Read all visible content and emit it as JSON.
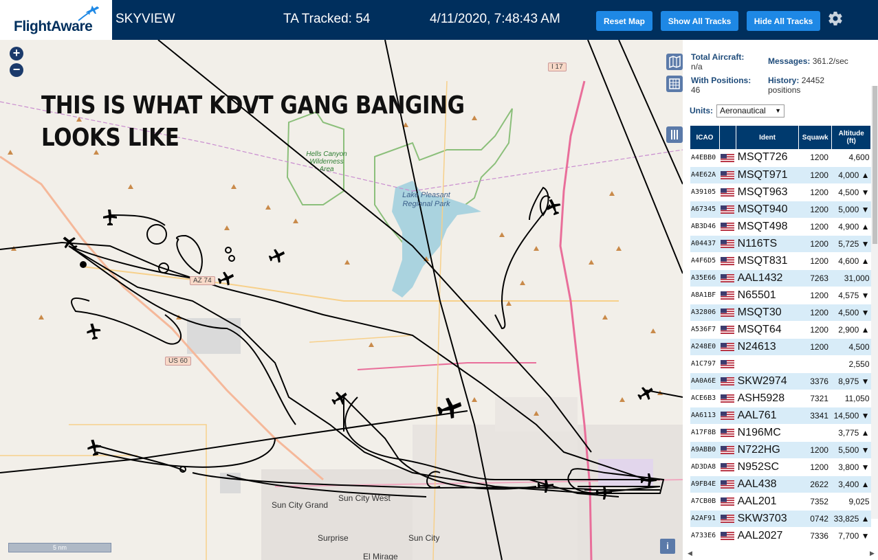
{
  "header": {
    "logo_text": "FlightAware",
    "app_title": "SKYVIEW",
    "ta_tracked": "TA Tracked: 54",
    "datetime": "4/11/2020, 7:48:43 AM",
    "reset_map": "Reset Map",
    "show_all_tracks": "Show All Tracks",
    "hide_all_tracks": "Hide All Tracks"
  },
  "map": {
    "overlay_line1": "THIS IS WHAT KDVT GANG BANGING",
    "overlay_line2": "LOOKS LIKE",
    "zoom_in": "+",
    "zoom_out": "−",
    "scale": "5 nm",
    "info": "i",
    "labels": {
      "park": "Hells Canyon Wilderness Area",
      "lake": "Lake Pleasant Regional Park",
      "sun_city_grand": "Sun City Grand",
      "sun_city_west": "Sun City West",
      "surprise": "Surprise",
      "sun_city": "Sun City",
      "el_mirage": "El Mirage",
      "az74": "AZ 74",
      "us60": "US 60",
      "i17": "I 17"
    }
  },
  "stats": {
    "total_aircraft_label": "Total Aircraft:",
    "total_aircraft_value": "n/a",
    "messages_label": "Messages:",
    "messages_value": "361.2/sec",
    "with_positions_label": "With Positions:",
    "with_positions_value": "46",
    "history_label": "History:",
    "history_value": "24452",
    "history_unit": "positions",
    "units_label": "Units:",
    "units_value": "Aeronautical"
  },
  "table": {
    "headers": {
      "icao": "ICAO",
      "ident": "Ident",
      "squawk": "Squawk",
      "altitude": "Altitude",
      "altitude_unit": "(ft)"
    },
    "rows": [
      {
        "icao": "A4EBB0",
        "ident": "MSQT726",
        "squawk": "1200",
        "alt": "4,600"
      },
      {
        "icao": "A4E62A",
        "ident": "MSQT971",
        "squawk": "1200",
        "alt": "4,000 ▲"
      },
      {
        "icao": "A39105",
        "ident": "MSQT963",
        "squawk": "1200",
        "alt": "4,500 ▼"
      },
      {
        "icao": "A67345",
        "ident": "MSQT940",
        "squawk": "1200",
        "alt": "5,000 ▼"
      },
      {
        "icao": "AB3D46",
        "ident": "MSQT498",
        "squawk": "1200",
        "alt": "4,900 ▲"
      },
      {
        "icao": "A04437",
        "ident": "N116TS",
        "squawk": "1200",
        "alt": "5,725 ▼"
      },
      {
        "icao": "A4F6D5",
        "ident": "MSQT831",
        "squawk": "1200",
        "alt": "4,600 ▲"
      },
      {
        "icao": "A35E66",
        "ident": "AAL1432",
        "squawk": "7263",
        "alt": "31,000"
      },
      {
        "icao": "A8A1BF",
        "ident": "N65501",
        "squawk": "1200",
        "alt": "4,575 ▼"
      },
      {
        "icao": "A32806",
        "ident": "MSQT30",
        "squawk": "1200",
        "alt": "4,500 ▼"
      },
      {
        "icao": "A536F7",
        "ident": "MSQT64",
        "squawk": "1200",
        "alt": "2,900 ▲"
      },
      {
        "icao": "A248E0",
        "ident": "N24613",
        "squawk": "1200",
        "alt": "4,500"
      },
      {
        "icao": "A1C797",
        "ident": "",
        "squawk": "",
        "alt": "2,550"
      },
      {
        "icao": "AA0A6E",
        "ident": "SKW2974",
        "squawk": "3376",
        "alt": "8,975 ▼"
      },
      {
        "icao": "ACE6B3",
        "ident": "ASH5928",
        "squawk": "7321",
        "alt": "11,050"
      },
      {
        "icao": "AA6113",
        "ident": "AAL761",
        "squawk": "3341",
        "alt": "14,500 ▼"
      },
      {
        "icao": "A17F8B",
        "ident": "N196MC",
        "squawk": "",
        "alt": "3,775 ▲"
      },
      {
        "icao": "A9ABB0",
        "ident": "N722HG",
        "squawk": "1200",
        "alt": "5,500 ▼"
      },
      {
        "icao": "AD3DA8",
        "ident": "N952SC",
        "squawk": "1200",
        "alt": "3,800 ▼"
      },
      {
        "icao": "A9FB4E",
        "ident": "AAL438",
        "squawk": "2622",
        "alt": "3,400 ▲"
      },
      {
        "icao": "A7CB0B",
        "ident": "AAL201",
        "squawk": "7352",
        "alt": "9,025"
      },
      {
        "icao": "A2AF91",
        "ident": "SKW3703",
        "squawk": "0742",
        "alt": "33,825 ▲"
      },
      {
        "icao": "A733E6",
        "ident": "AAL2027",
        "squawk": "7336",
        "alt": "7,700 ▼"
      }
    ]
  }
}
